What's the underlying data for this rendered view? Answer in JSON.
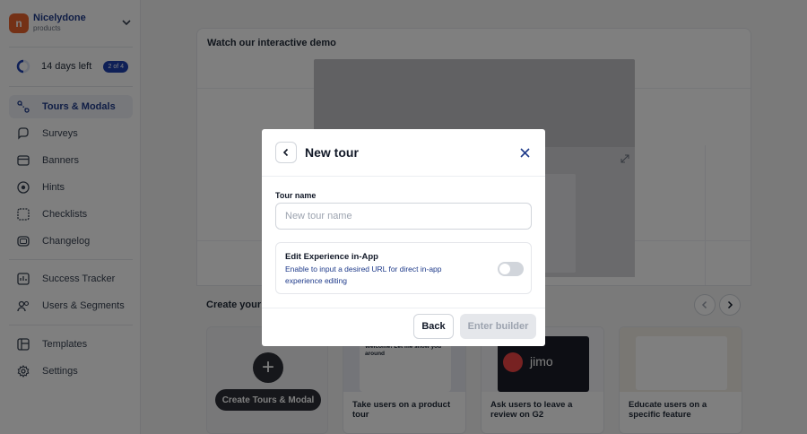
{
  "brand": {
    "name": "Nicelydone",
    "sub": "products",
    "logo_glyph": "n"
  },
  "trial": {
    "days_left": "14 days left",
    "badge": "2 of 4"
  },
  "sidebar": {
    "items": [
      {
        "label": "Tours & Modals",
        "icon": "tours-icon",
        "active": true
      },
      {
        "label": "Surveys",
        "icon": "surveys-icon"
      },
      {
        "label": "Banners",
        "icon": "banners-icon"
      },
      {
        "label": "Hints",
        "icon": "hints-icon"
      },
      {
        "label": "Checklists",
        "icon": "checklists-icon"
      },
      {
        "label": "Changelog",
        "icon": "changelog-icon"
      },
      {
        "label": "Success Tracker",
        "icon": "success-tracker-icon"
      },
      {
        "label": "Users & Segments",
        "icon": "users-segments-icon"
      },
      {
        "label": "Templates",
        "icon": "templates-icon"
      },
      {
        "label": "Settings",
        "icon": "gear-icon"
      }
    ]
  },
  "demo": {
    "title": "Watch our interactive demo"
  },
  "create": {
    "title": "Create your f",
    "create_button": "Create Tours & Modal",
    "cards": [
      {
        "caption": "Take users on a product tour",
        "thumb_text": "Welcome! Let me show you around"
      },
      {
        "caption": "Ask users to leave a review on G2",
        "thumb_text": "jimo"
      },
      {
        "caption": "Educate users on a specific feature"
      }
    ]
  },
  "modal": {
    "title": "New tour",
    "tour_name_label": "Tour name",
    "tour_name_placeholder": "New tour name",
    "tour_name_value": "",
    "edit_title": "Edit Experience in-App",
    "edit_desc": "Enable to input a desired URL for direct in-app experience editing",
    "toggle_on": false,
    "back_label": "Back",
    "enter_label": "Enter builder"
  },
  "colors": {
    "accent": "#1e3a8a",
    "brand": "#e8622c",
    "dark_button": "#2c2f36"
  }
}
